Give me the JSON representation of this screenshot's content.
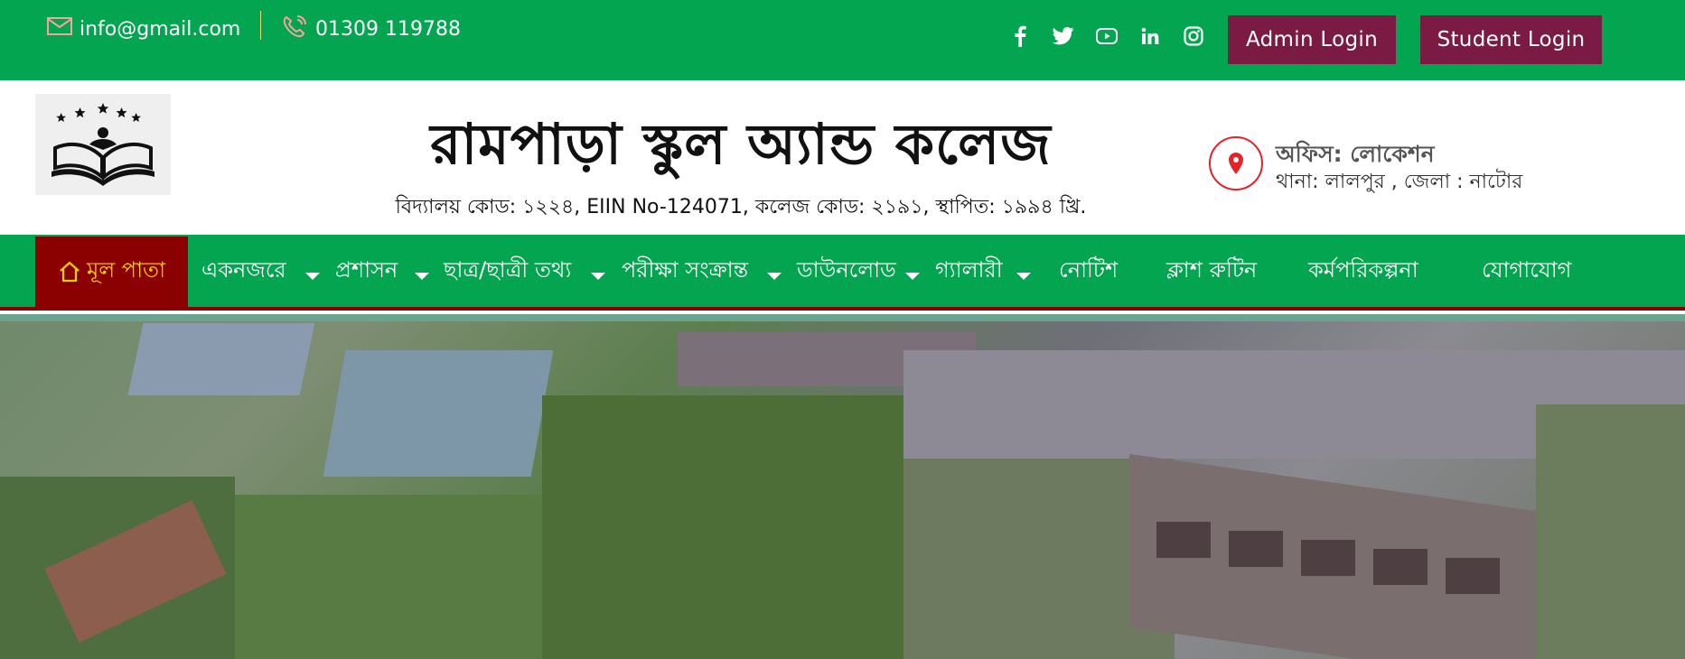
{
  "topbar": {
    "email": "info@gmail.com",
    "phone": "01309 119788",
    "social_icons": [
      "facebook-icon",
      "twitter-icon",
      "youtube-icon",
      "linkedin-icon",
      "instagram-icon"
    ],
    "admin_login": "Admin Login",
    "student_login": "Student Login"
  },
  "header": {
    "school_name": "রামপাড়া স্কুল অ্যান্ড কলেজ",
    "codes": "বিদ্যালয় কোড: ১২২৪, EIIN No-124071, কলেজ কোড: ২১৯১, স্থাপিত: ১৯৯৪ খ্রি.",
    "office_title": "অফিস: লোকেশন",
    "office_address": "থানা: লালপুর , জেলা : নাটোর"
  },
  "nav": {
    "home": "মূল পাতা",
    "items": [
      {
        "label": "একনজরে"
      },
      {
        "label": "প্রশাসন"
      },
      {
        "label": "ছাত্র/ছাত্রী তথ্য"
      },
      {
        "label": "পরীক্ষা সংক্রান্ত"
      },
      {
        "label": "ডাউনলোড"
      },
      {
        "label": "গ্যালারী"
      },
      {
        "label": "নোটিশ"
      },
      {
        "label": "ক্লাশ রুটিন"
      },
      {
        "label": "কর্মপরিকল্পনা"
      },
      {
        "label": "যোগাযোগ"
      }
    ]
  },
  "colors": {
    "brand_green": "#04a550",
    "login_maroon": "#7b1a42",
    "home_active": "#8b0000",
    "home_text": "#ffd400",
    "location_red": "#e52228"
  }
}
